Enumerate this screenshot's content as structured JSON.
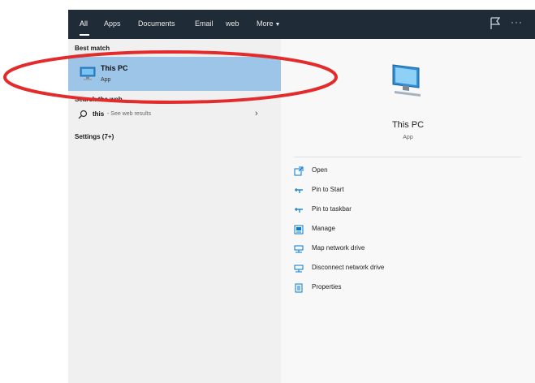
{
  "tabs": [
    {
      "label": "All"
    },
    {
      "label": "Apps"
    },
    {
      "label": "Documents"
    },
    {
      "label": "Email"
    },
    {
      "label": "web"
    },
    {
      "label": "More"
    }
  ],
  "left": {
    "best_match_header": "Best match",
    "best_match": {
      "title": "This PC",
      "subtitle": "App"
    },
    "search_web_header": "Search the web",
    "web_result": {
      "query": "this",
      "hint": "- See web results"
    },
    "settings_header": "Settings (7+)"
  },
  "preview": {
    "title": "This PC",
    "subtitle": "App"
  },
  "actions": [
    {
      "label": "Open",
      "icon": "open-icon"
    },
    {
      "label": "Pin to Start",
      "icon": "pin-icon"
    },
    {
      "label": "Pin to taskbar",
      "icon": "pin-icon"
    },
    {
      "label": "Manage",
      "icon": "manage-icon"
    },
    {
      "label": "Map network drive",
      "icon": "network-drive-icon"
    },
    {
      "label": "Disconnect network drive",
      "icon": "network-drive-icon"
    },
    {
      "label": "Properties",
      "icon": "properties-icon"
    }
  ],
  "colors": {
    "topbar": "#1f2b36",
    "selection": "#9cc5e8",
    "accent": "#0078d7",
    "annotation": "#e32b2b"
  }
}
